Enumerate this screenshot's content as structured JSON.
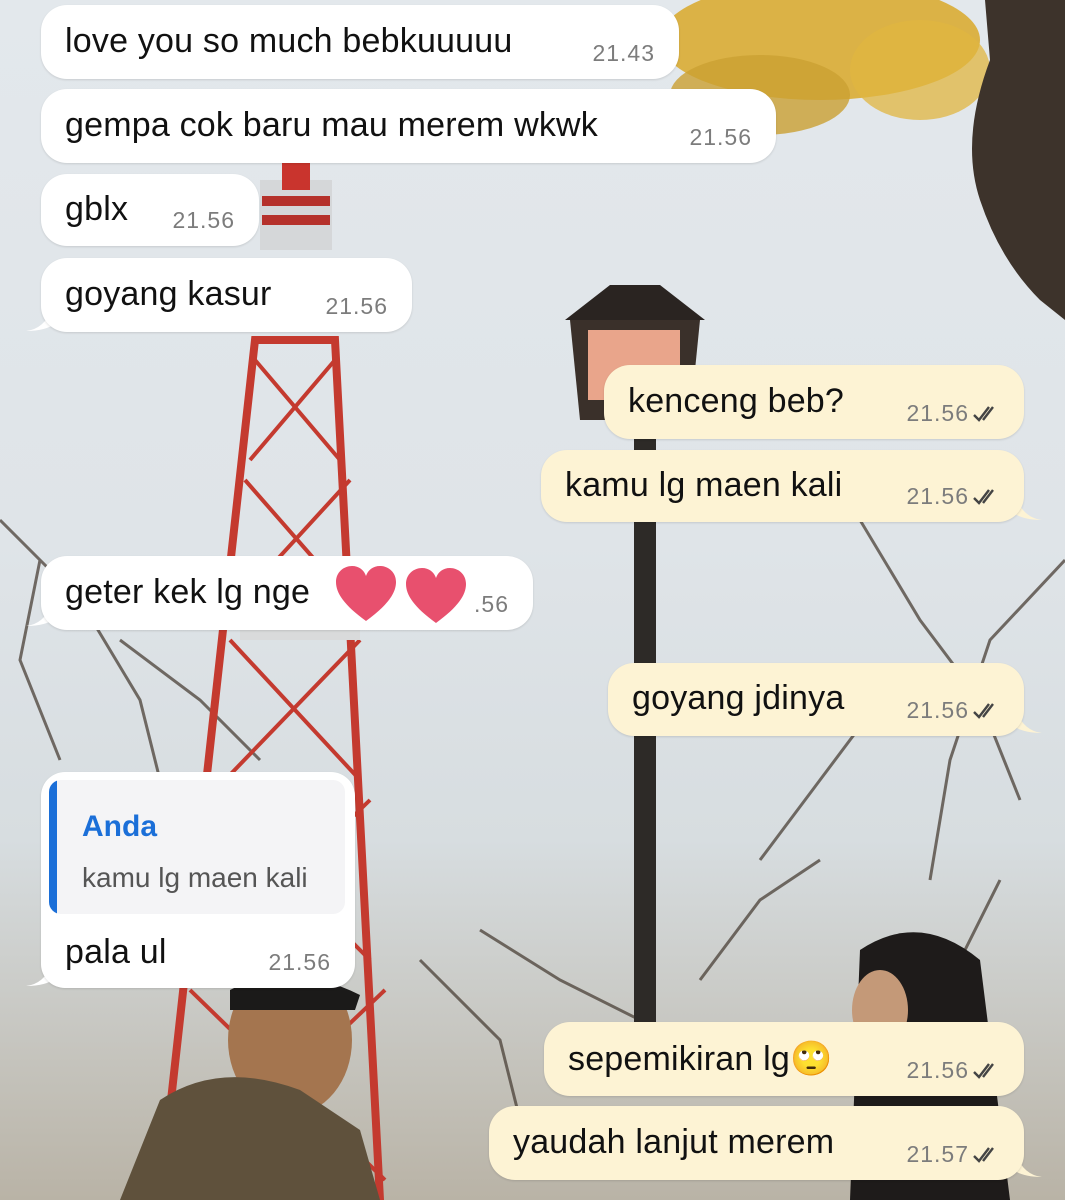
{
  "conversation": {
    "messages": [
      {
        "id": "m1",
        "direction": "incoming",
        "text": "love you so much bebkuuuuu",
        "time": "21.43"
      },
      {
        "id": "m2",
        "direction": "incoming",
        "text": "gempa cok baru mau merem wkwk",
        "time": "21.56"
      },
      {
        "id": "m3",
        "direction": "incoming",
        "text": "gblx",
        "time": "21.56"
      },
      {
        "id": "m4",
        "direction": "incoming",
        "text": "goyang kasur",
        "time": "21.56"
      },
      {
        "id": "m5",
        "direction": "outgoing",
        "text": "kenceng beb?",
        "time": "21.56",
        "status": "read"
      },
      {
        "id": "m6",
        "direction": "outgoing",
        "text": "kamu lg maen kali",
        "time": "21.56",
        "status": "read"
      },
      {
        "id": "m7",
        "direction": "incoming",
        "text": "geter kek lg nge",
        "time": ".56",
        "sticker_overlay": "two-hearts"
      },
      {
        "id": "m8",
        "direction": "outgoing",
        "text": "goyang jdinya",
        "time": "21.56",
        "status": "read"
      },
      {
        "id": "m9",
        "direction": "incoming",
        "text": "pala ul",
        "time": "21.56",
        "reply": {
          "author": "Anda",
          "text": "kamu lg maen kali"
        }
      },
      {
        "id": "m10",
        "direction": "outgoing",
        "text": "sepemikiran lg🙄",
        "time": "21.56",
        "status": "read"
      },
      {
        "id": "m11",
        "direction": "outgoing",
        "text": "yaudah lanjut merem",
        "time": "21.57",
        "status": "read"
      }
    ]
  },
  "colors": {
    "incoming_bubble": "#ffffff",
    "outgoing_bubble": "#fdf3d4",
    "timestamp": "#7c7c7c",
    "reply_accent": "#1b6fd8",
    "heart": "#e8506e"
  },
  "icons": {
    "read_receipt": "double-check-icon",
    "sticker": "heart-icon"
  }
}
